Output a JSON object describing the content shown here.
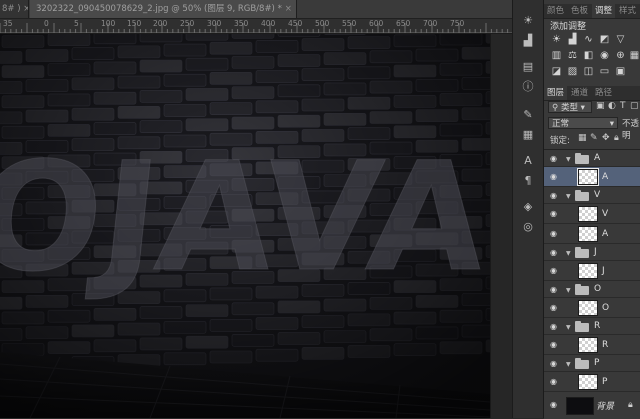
{
  "document": {
    "tabs": [
      {
        "label": "8# ) ×",
        "active": false
      },
      {
        "label": "3202322_090450078629_2.jpg @ 50% (图层 9, RGB/8#) *",
        "active": true
      }
    ],
    "close_glyph": "×",
    "ruler_labels": [
      "35",
      "0",
      "5",
      "100",
      "150",
      "200",
      "250",
      "300",
      "350",
      "400",
      "450",
      "500",
      "550",
      "600",
      "650",
      "700",
      "750"
    ],
    "canvas_text": "OJAVA"
  },
  "icon_strip": {
    "icons": [
      "sun-icon",
      "histogram-icon",
      "history-icon",
      "info-icon",
      "brush-icon",
      "character-icon",
      "paragraph-icon",
      "layers-icon",
      "channels-icon",
      "paths-icon"
    ]
  },
  "top_panel": {
    "tabs": [
      "颜色",
      "色板",
      "调整",
      "样式"
    ],
    "active_tab": "调整",
    "title": "添加调整"
  },
  "layers_panel": {
    "tabs": [
      "图层",
      "通道",
      "路径"
    ],
    "active_tab": "图层",
    "filter_label": "类型",
    "blend_mode": "正常",
    "opacity_label": "不透明",
    "lock_label": "锁定:",
    "layers": [
      {
        "type": "group",
        "name": "A",
        "expanded": true
      },
      {
        "type": "layer",
        "name": "A",
        "selected": true
      },
      {
        "type": "group",
        "name": "V",
        "expanded": true
      },
      {
        "type": "layer",
        "name": "V"
      },
      {
        "type": "layer",
        "name": "A"
      },
      {
        "type": "group",
        "name": "J",
        "expanded": true
      },
      {
        "type": "layer",
        "name": "J"
      },
      {
        "type": "group",
        "name": "O",
        "expanded": true
      },
      {
        "type": "layer",
        "name": "O"
      },
      {
        "type": "group",
        "name": "R",
        "expanded": true
      },
      {
        "type": "layer",
        "name": "R"
      },
      {
        "type": "group",
        "name": "P",
        "expanded": true
      },
      {
        "type": "layer",
        "name": "P"
      },
      {
        "type": "background",
        "name": "背景"
      }
    ]
  },
  "colors": {
    "selected_layer": "#54627a",
    "panel_bg": "#393939",
    "canvas_bg": "#121216"
  }
}
